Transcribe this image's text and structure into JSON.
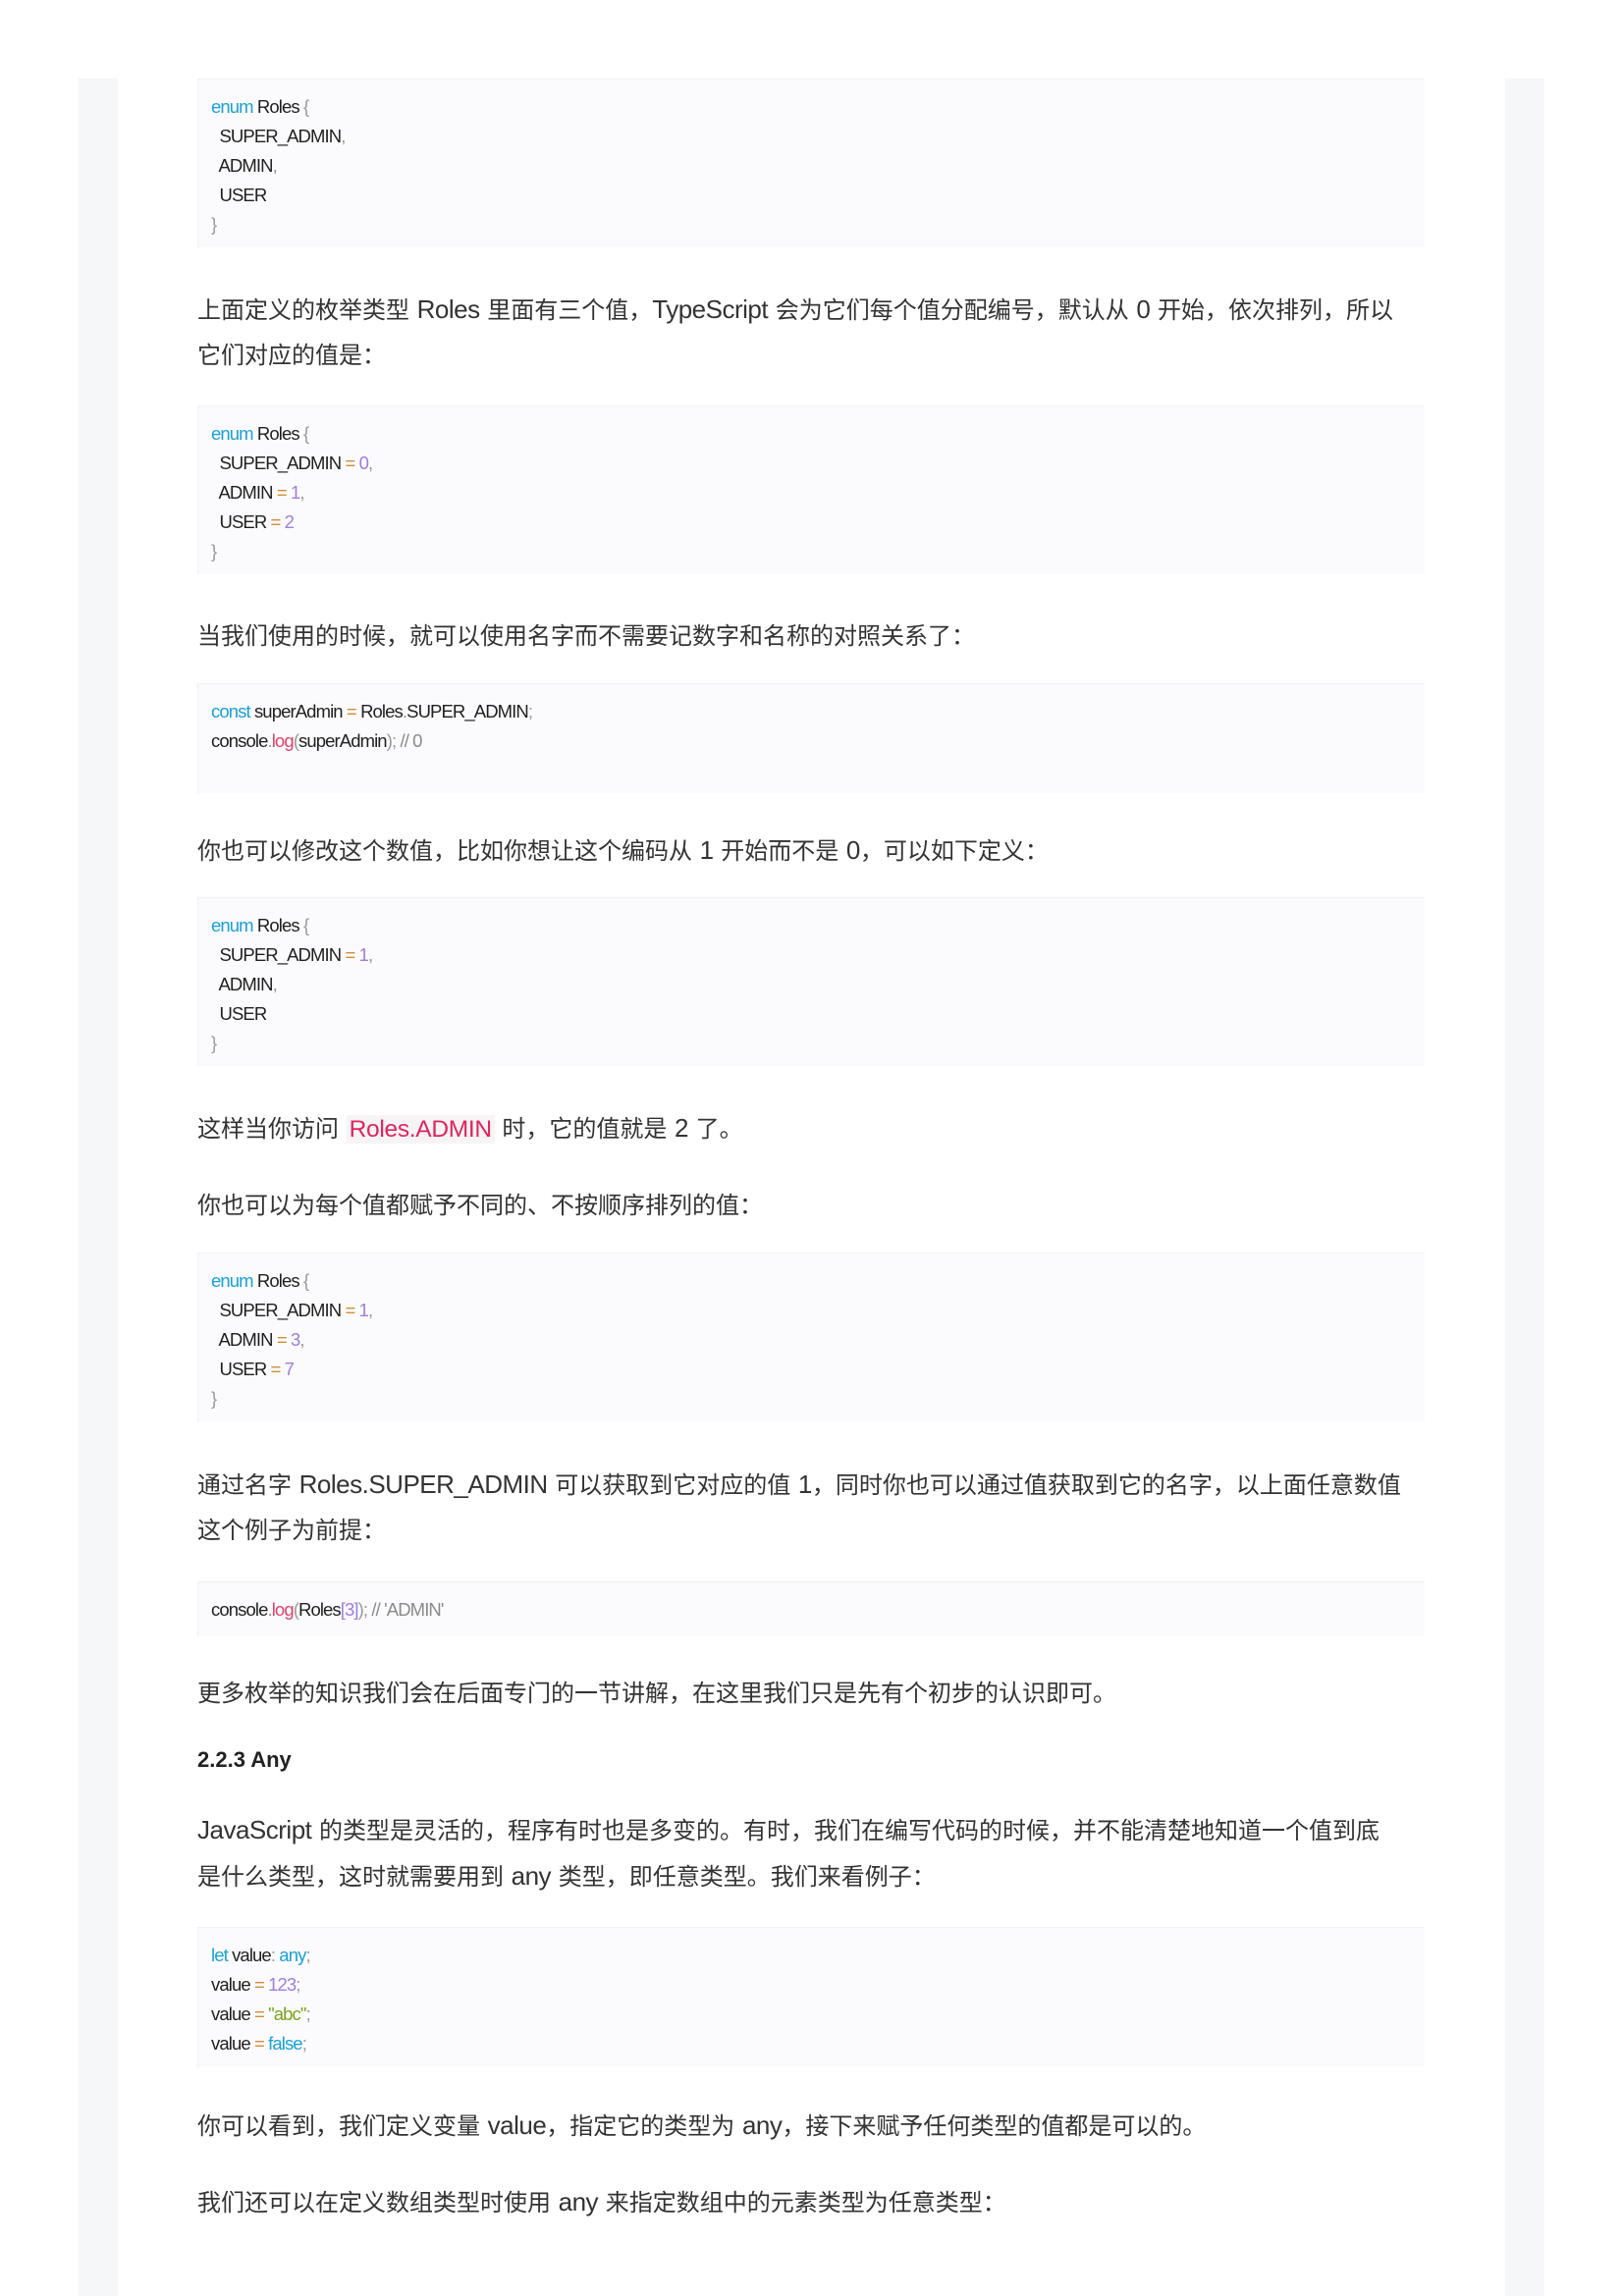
{
  "blocks": [
    {
      "kind": "code",
      "id": "code1",
      "lines": [
        [
          [
            "kw",
            "enum"
          ],
          [
            "t",
            " Roles "
          ],
          [
            "pun",
            "{"
          ]
        ],
        [
          [
            "t",
            "  SUPER_ADMIN"
          ],
          [
            "pun",
            ","
          ]
        ],
        [
          [
            "t",
            "  ADMIN"
          ],
          [
            "pun",
            ","
          ]
        ],
        [
          [
            "t",
            "  USER"
          ]
        ],
        [
          [
            "pun",
            "}"
          ]
        ]
      ]
    },
    {
      "kind": "para",
      "id": "p1",
      "lines": [
        [
          [
            "c",
            "上面定义的枚举类型 "
          ],
          [
            "l",
            "Roles"
          ],
          [
            "c",
            " 里面有三个值，"
          ],
          [
            "l",
            "TypeScript"
          ],
          [
            "c",
            " 会为它们每个值分配编号，默认从 "
          ],
          [
            "l",
            "0"
          ],
          [
            "c",
            " 开始，依次排列，所以"
          ]
        ],
        [
          [
            "c",
            "它们对应的值是："
          ]
        ]
      ]
    },
    {
      "kind": "code",
      "id": "code2",
      "lines": [
        [
          [
            "kw",
            "enum"
          ],
          [
            "t",
            " Roles "
          ],
          [
            "pun",
            "{"
          ]
        ],
        [
          [
            "t",
            "  SUPER_ADMIN "
          ],
          [
            "op",
            "="
          ],
          [
            "num",
            " 0"
          ],
          [
            "pun",
            ","
          ]
        ],
        [
          [
            "t",
            "  ADMIN "
          ],
          [
            "op",
            "="
          ],
          [
            "num",
            " 1"
          ],
          [
            "pun",
            ","
          ]
        ],
        [
          [
            "t",
            "  USER "
          ],
          [
            "op",
            "="
          ],
          [
            "num",
            " 2"
          ]
        ],
        [
          [
            "pun",
            "}"
          ]
        ]
      ]
    },
    {
      "kind": "para",
      "id": "p2",
      "lines": [
        [
          [
            "c",
            "当我们使用的时候，就可以使用名字而不需要记数字和名称的对照关系了："
          ]
        ]
      ]
    },
    {
      "kind": "code",
      "id": "code3",
      "lines": [
        [
          [
            "kw",
            "const"
          ],
          [
            "t",
            " superAdmin "
          ],
          [
            "op",
            "="
          ],
          [
            "t",
            " Roles"
          ],
          [
            "pun",
            "."
          ],
          [
            "t",
            "SUPER_ADMIN"
          ],
          [
            "pun",
            ";"
          ]
        ],
        [
          [
            "t",
            "console"
          ],
          [
            "pun",
            "."
          ],
          [
            "fn",
            "log"
          ],
          [
            "pun",
            "("
          ],
          [
            "t",
            "superAdmin"
          ],
          [
            "pun",
            ");"
          ],
          [
            "cm",
            " // 0"
          ]
        ]
      ]
    },
    {
      "kind": "para",
      "id": "p3",
      "lines": [
        [
          [
            "c",
            "你也可以修改这个数值，比如你想让这个编码从 "
          ],
          [
            "l",
            "1"
          ],
          [
            "c",
            " 开始而不是 "
          ],
          [
            "l",
            "0"
          ],
          [
            "c",
            "，可以如下定义："
          ]
        ]
      ]
    },
    {
      "kind": "code",
      "id": "code4",
      "lines": [
        [
          [
            "kw",
            "enum"
          ],
          [
            "t",
            " Roles "
          ],
          [
            "pun",
            "{"
          ]
        ],
        [
          [
            "t",
            "  SUPER_ADMIN "
          ],
          [
            "op",
            "="
          ],
          [
            "num",
            " 1"
          ],
          [
            "pun",
            ","
          ]
        ],
        [
          [
            "t",
            "  ADMIN"
          ],
          [
            "pun",
            ","
          ]
        ],
        [
          [
            "t",
            "  USER"
          ]
        ],
        [
          [
            "pun",
            "}"
          ]
        ]
      ]
    },
    {
      "kind": "para",
      "id": "p4",
      "lines": [
        [
          [
            "c",
            "这样当你访问 "
          ],
          [
            "ic",
            "Roles.ADMIN"
          ],
          [
            "c",
            " 时，它的值就是 "
          ],
          [
            "l",
            "2"
          ],
          [
            "c",
            " 了。"
          ]
        ]
      ]
    },
    {
      "kind": "para",
      "id": "p5",
      "lines": [
        [
          [
            "c",
            "你也可以为每个值都赋予不同的、不按顺序排列的值："
          ]
        ]
      ]
    },
    {
      "kind": "code",
      "id": "code5",
      "lines": [
        [
          [
            "kw",
            "enum"
          ],
          [
            "t",
            " Roles "
          ],
          [
            "pun",
            "{"
          ]
        ],
        [
          [
            "t",
            "  SUPER_ADMIN "
          ],
          [
            "op",
            "="
          ],
          [
            "num",
            " 1"
          ],
          [
            "pun",
            ","
          ]
        ],
        [
          [
            "t",
            "  ADMIN "
          ],
          [
            "op",
            "="
          ],
          [
            "num",
            " 3"
          ],
          [
            "pun",
            ","
          ]
        ],
        [
          [
            "t",
            "  USER "
          ],
          [
            "op",
            "="
          ],
          [
            "num",
            " 7"
          ]
        ],
        [
          [
            "pun",
            "}"
          ]
        ]
      ]
    },
    {
      "kind": "para",
      "id": "p6",
      "lines": [
        [
          [
            "c",
            "通过名字 "
          ],
          [
            "l",
            "Roles.SUPER_ADMIN"
          ],
          [
            "c",
            " 可以获取到它对应的值 "
          ],
          [
            "l",
            "1"
          ],
          [
            "c",
            "，同时你也可以通过值获取到它的名字，以上面任意数值"
          ]
        ],
        [
          [
            "c",
            "这个例子为前提："
          ]
        ]
      ]
    },
    {
      "kind": "code",
      "id": "code6",
      "lines": [
        [
          [
            "t",
            "console"
          ],
          [
            "pun",
            "."
          ],
          [
            "fn",
            "log"
          ],
          [
            "pun",
            "("
          ],
          [
            "t",
            "Roles"
          ],
          [
            "num",
            "[3]"
          ],
          [
            "pun",
            ");"
          ],
          [
            "cm",
            " // 'ADMIN'"
          ]
        ]
      ]
    },
    {
      "kind": "para",
      "id": "p7",
      "lines": [
        [
          [
            "c",
            "更多枚举的知识我们会在后面专门的一节讲解，在这里我们只是先有个初步的认识即可。"
          ]
        ]
      ]
    },
    {
      "kind": "heading",
      "id": "h1",
      "text": "2.2.3 Any"
    },
    {
      "kind": "para",
      "id": "p8",
      "lines": [
        [
          [
            "l",
            "JavaScript"
          ],
          [
            "c",
            "  的类型是灵活的，程序有时也是多变的。有时，我们在编写代码的时候，并不能清楚地知道一个值到底"
          ]
        ],
        [
          [
            "c",
            "是什么类型，这时就需要用到 "
          ],
          [
            "l",
            "any"
          ],
          [
            "c",
            " 类型，即任意类型。我们来看例子："
          ]
        ]
      ]
    },
    {
      "kind": "code",
      "id": "code7",
      "lines": [
        [
          [
            "kw",
            "let"
          ],
          [
            "t",
            " value"
          ],
          [
            "pun",
            ":"
          ],
          [
            "kw",
            " any"
          ],
          [
            "pun",
            ";"
          ]
        ],
        [
          [
            "t",
            "value "
          ],
          [
            "op",
            "="
          ],
          [
            "num",
            " 123"
          ],
          [
            "pun",
            ";"
          ]
        ],
        [
          [
            "t",
            "value "
          ],
          [
            "op",
            "="
          ],
          [
            "str",
            " \"abc\""
          ],
          [
            "pun",
            ";"
          ]
        ],
        [
          [
            "t",
            "value "
          ],
          [
            "op",
            "="
          ],
          [
            "kw",
            " false"
          ],
          [
            "pun",
            ";"
          ]
        ]
      ]
    },
    {
      "kind": "para",
      "id": "p9",
      "lines": [
        [
          [
            "c",
            "你可以看到，我们定义变量 "
          ],
          [
            "l",
            "value"
          ],
          [
            "c",
            "，指定它的类型为 "
          ],
          [
            "l",
            "any"
          ],
          [
            "c",
            "，接下来赋予任何类型的值都是可以的。"
          ]
        ]
      ]
    },
    {
      "kind": "para",
      "id": "p10",
      "lines": [
        [
          [
            "c",
            "我们还可以在定义数组类型时使用 "
          ],
          [
            "l",
            "any"
          ],
          [
            "c",
            " 来指定数组中的元素类型为任意类型："
          ]
        ]
      ]
    }
  ]
}
